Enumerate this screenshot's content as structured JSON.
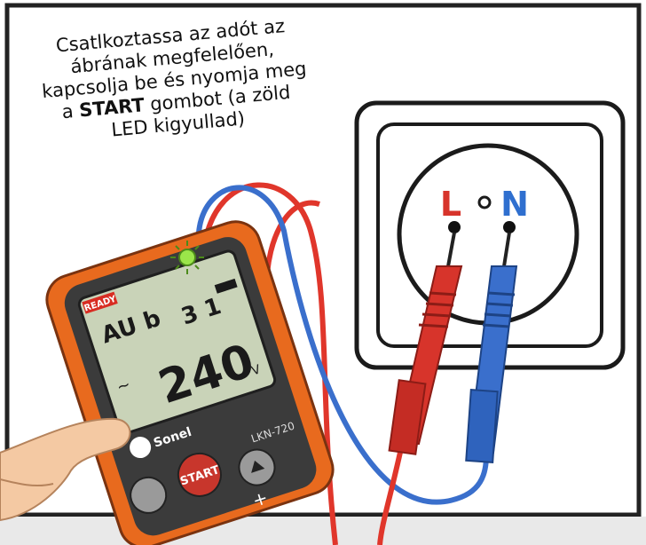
{
  "instruction": {
    "line1": "Csatlkoztassa az adót az",
    "line2": "ábrának megfelelően,",
    "line3": "kapcsolja be és nyomja meg",
    "line4_prefix": "a ",
    "line4_bold": "START",
    "line4_suffix": " gombot (a zöld",
    "line5": "LED kigyullad)"
  },
  "device": {
    "ready_label": "READY",
    "display_code": "AU b",
    "display_counter": "3 1",
    "display_voltage": "240",
    "display_unit": "V",
    "display_tilde": "~",
    "brand": "Sonel",
    "model": "LKN-720",
    "start_label": "START",
    "plus_label": "+",
    "led_color": "#9be54a"
  },
  "socket": {
    "live_label": "L",
    "neutral_label": "N",
    "live_color": "#d7342b",
    "neutral_color": "#2f6fcf"
  },
  "wires": {
    "red": "#e0362b",
    "blue": "#3a6fcc"
  }
}
